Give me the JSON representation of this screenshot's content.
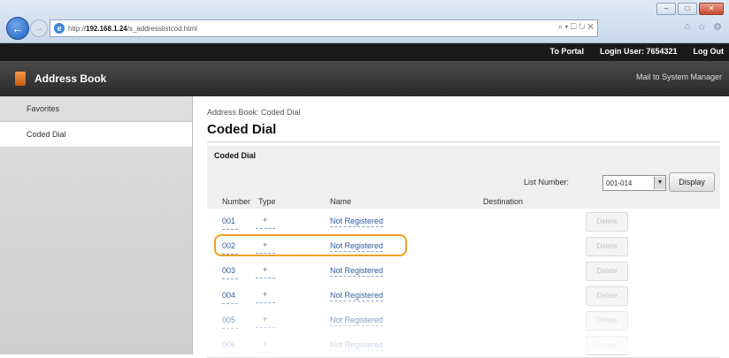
{
  "browser": {
    "url_prefix": "http://",
    "url_host": "192.168.1.24",
    "url_path": "/s_addresslistcod.html",
    "address_tools": "⌕ ▾ ☐ ↻ ✕",
    "icons": [
      "back-arrow-icon",
      "forward-arrow-icon",
      "home-icon",
      "star-icon",
      "gear-icon"
    ]
  },
  "banner": {
    "portal_label": "To Portal",
    "login_label": "Login User: 7654321",
    "logout_label": "Log Out"
  },
  "header": {
    "title": "Address Book",
    "mail_link": "Mail to System Manager"
  },
  "sidebar": {
    "items": [
      {
        "label": "Favorites"
      },
      {
        "label": "Coded Dial"
      }
    ]
  },
  "main": {
    "breadcrumb": "Address Book: Coded Dial",
    "page_title": "Coded Dial",
    "section_title": "Coded Dial",
    "list_number_label": "List Number:",
    "list_number_value": "001-014",
    "display_label": "Display",
    "columns": [
      "Number",
      "Type",
      "Name",
      "Destination"
    ],
    "rows": [
      {
        "number": "001",
        "type": "+",
        "name": "Not Registered",
        "delete": "Delete"
      },
      {
        "number": "002",
        "type": "+",
        "name": "Not Registered",
        "delete": "Delete"
      },
      {
        "number": "003",
        "type": "+",
        "name": "Not Registered",
        "delete": "Delete"
      },
      {
        "number": "004",
        "type": "+",
        "name": "Not Registered",
        "delete": "Delete"
      },
      {
        "number": "005",
        "type": "+",
        "name": "Not Registered",
        "delete": "Delete"
      },
      {
        "number": "006",
        "type": "+",
        "name": "Not Registered",
        "delete": "Delete"
      }
    ]
  },
  "colors": {
    "accent_highlight": "#f0a21f",
    "link": "#2d5c9f",
    "banner": "#1b1b1b",
    "header": "#2a2a2a"
  }
}
